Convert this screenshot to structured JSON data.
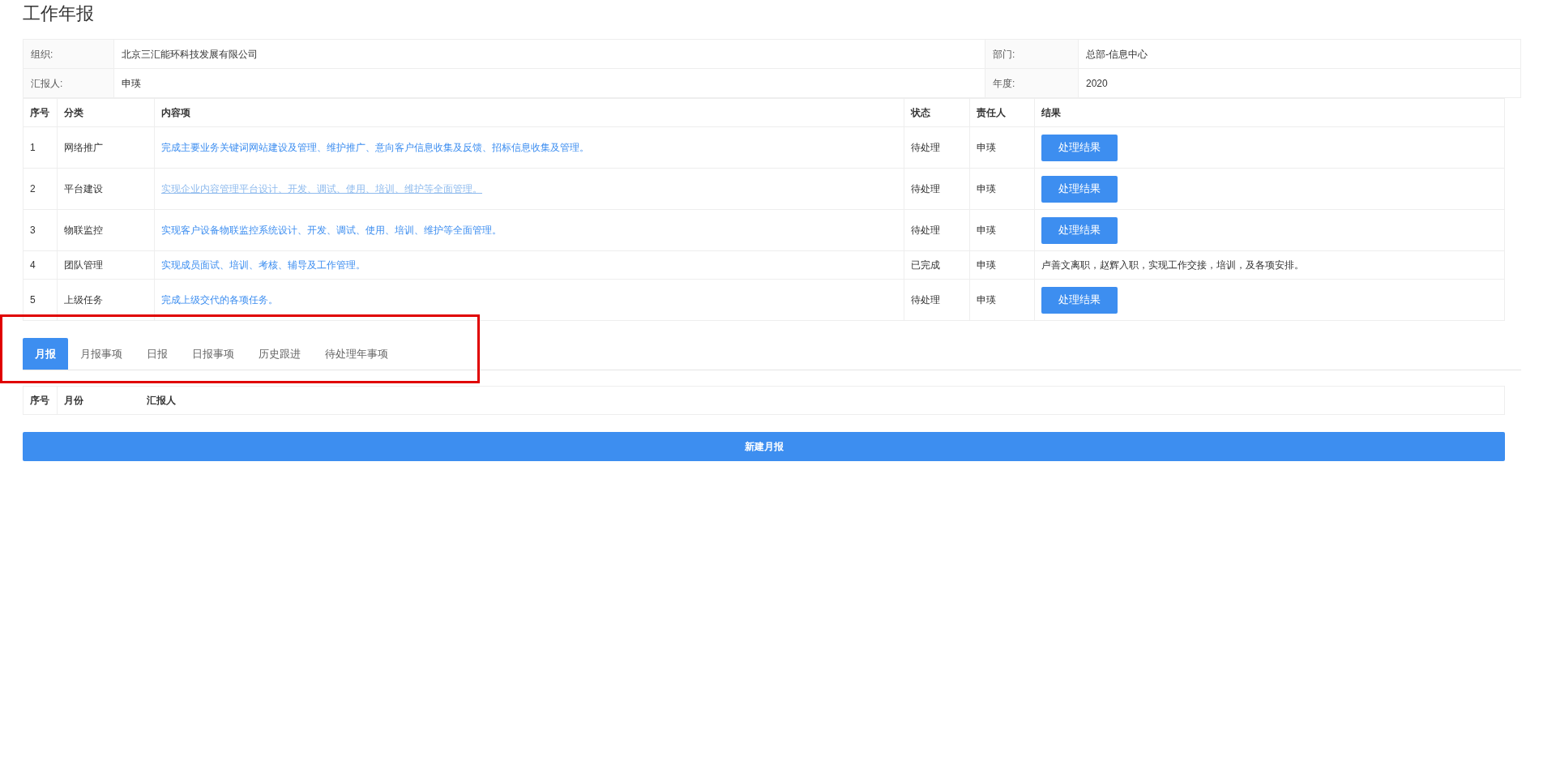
{
  "page_title": "工作年报",
  "info": [
    {
      "label": "组织:",
      "value": "北京三汇能环科技发展有限公司"
    },
    {
      "label": "部门:",
      "value": "总部-信息中心"
    },
    {
      "label": "汇报人:",
      "value": "申瑛"
    },
    {
      "label": "年度:",
      "value": "2020"
    }
  ],
  "tasks": {
    "columns": [
      "序号",
      "分类",
      "内容项",
      "状态",
      "责任人",
      "结果"
    ],
    "rows": [
      {
        "no": "1",
        "category": "网络推广",
        "content": "完成主要业务关键词网站建设及管理、维护推广、意向客户信息收集及反馈、招标信息收集及管理。",
        "hovered": false,
        "status": "待处理",
        "owner": "申瑛",
        "result": {
          "kind": "button",
          "text": "处理结果"
        }
      },
      {
        "no": "2",
        "category": "平台建设",
        "content": "实现企业内容管理平台设计、开发、调试、使用、培训、维护等全面管理。",
        "hovered": true,
        "status": "待处理",
        "owner": "申瑛",
        "result": {
          "kind": "button",
          "text": "处理结果"
        }
      },
      {
        "no": "3",
        "category": "物联监控",
        "content": "实现客户设备物联监控系统设计、开发、调试、使用、培训、维护等全面管理。",
        "hovered": false,
        "status": "待处理",
        "owner": "申瑛",
        "result": {
          "kind": "button",
          "text": "处理结果"
        }
      },
      {
        "no": "4",
        "category": "团队管理",
        "content": "实现成员面试、培训、考核、辅导及工作管理。",
        "hovered": false,
        "status": "已完成",
        "owner": "申瑛",
        "result": {
          "kind": "text",
          "text": "卢善文离职，赵辉入职，实现工作交接，培训，及各项安排。"
        }
      },
      {
        "no": "5",
        "category": "上级任务",
        "content": "完成上级交代的各项任务。",
        "hovered": false,
        "status": "待处理",
        "owner": "申瑛",
        "result": {
          "kind": "button",
          "text": "处理结果"
        }
      }
    ]
  },
  "tabs": [
    {
      "label": "月报",
      "selected": true
    },
    {
      "label": "月报事项",
      "selected": false
    },
    {
      "label": "日报",
      "selected": false
    },
    {
      "label": "日报事项",
      "selected": false
    },
    {
      "label": "历史跟进",
      "selected": false
    },
    {
      "label": "待处理年事项",
      "selected": false
    }
  ],
  "tabs_highlighted": true,
  "monthly": {
    "columns": [
      "序号",
      "月份",
      "汇报人"
    ]
  },
  "new_button": "新建月报"
}
